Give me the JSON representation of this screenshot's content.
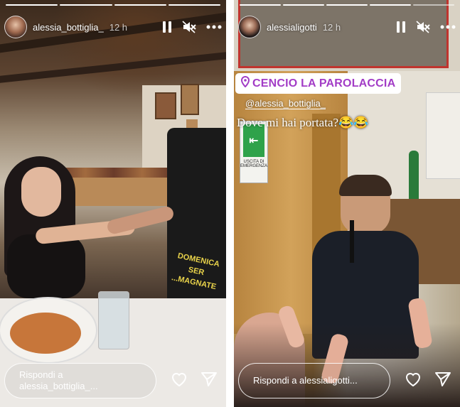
{
  "left_story": {
    "username": "alessia_bottiglia_",
    "time": "12 h",
    "progress_total": 4,
    "progress_done": 4,
    "reply_placeholder_line1": "Rispondi a",
    "reply_placeholder_line2": "alessia_bottiglia_...",
    "apron_line1": "DOMENICA SER",
    "apron_line2": "...MAGNATE",
    "icons": [
      "pause-icon",
      "mute-icon",
      "more-icon",
      "heart-icon",
      "send-icon"
    ]
  },
  "right_story": {
    "username": "alessialigotti",
    "time": "12 h",
    "progress_total": 5,
    "progress_done": 4,
    "location_label": "CENCIO LA PAROLACCIA",
    "mention": "@alessia_bottiglia_",
    "caption": "Dove mi hai portata?😂😂",
    "emergency_line1": "USCITA DI",
    "emergency_line2": "EMERGENZA",
    "reply_placeholder": "Rispondi a alessialigotti...",
    "icons": [
      "pause-icon",
      "mute-icon",
      "more-icon",
      "heart-icon",
      "send-icon",
      "location-pin-icon"
    ]
  },
  "colors": {
    "location_accent": "#a23cc6",
    "overlay_text": "#ffffff"
  }
}
